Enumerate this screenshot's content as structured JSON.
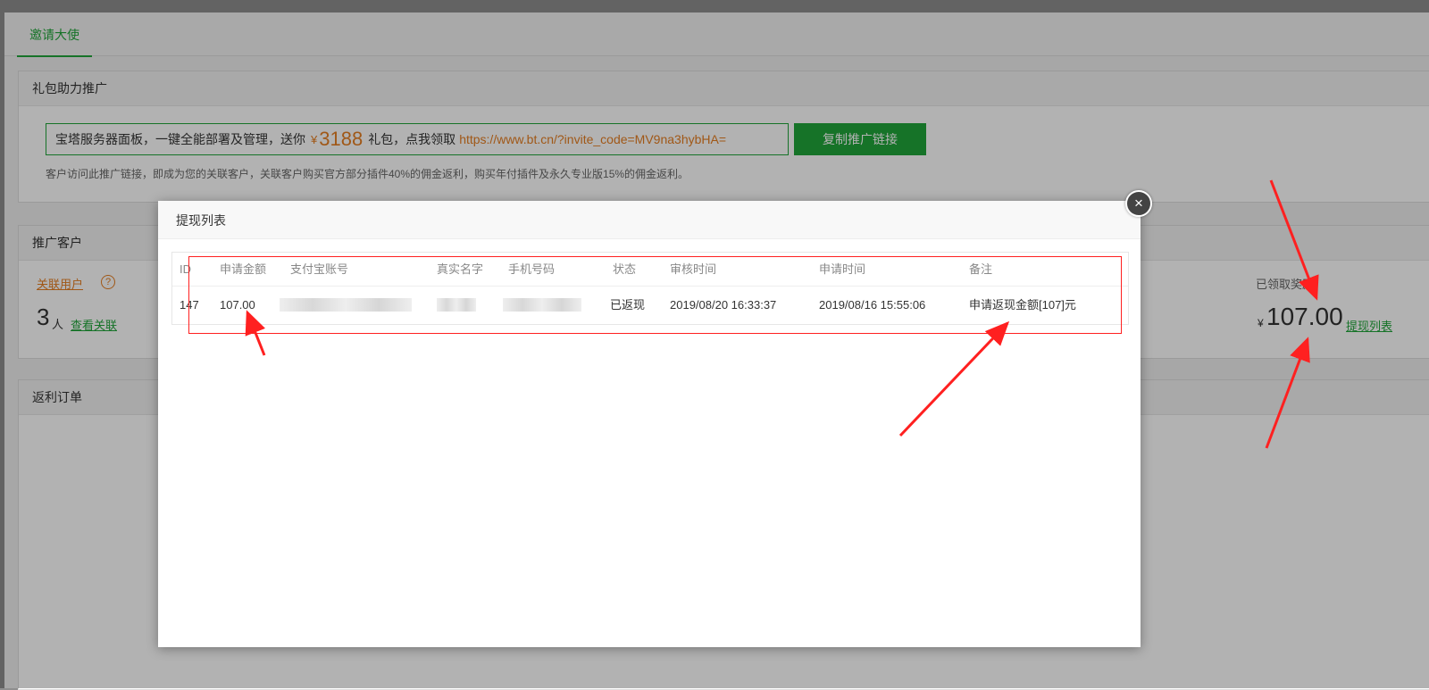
{
  "tabs": {
    "active": "邀请大使"
  },
  "gift_panel": {
    "title": "礼包助力推广",
    "invite_prefix": "宝塔服务器面板，一键全能部署及管理，送你",
    "currency": "¥",
    "gift_amount": "3188",
    "invite_middle": "礼包，点我领取",
    "invite_url": "https://www.bt.cn/?invite_code=MV9na3hybHA=",
    "copy_button": "复制推广链接",
    "note": "客户访问此推广链接，即成为您的关联客户，关联客户购买官方部分插件40%的佣金返利，购买年付插件及永久专业版15%的佣金返利。"
  },
  "customers_panel": {
    "title": "推广客户",
    "linked_users_label": "关联用户",
    "help_icon": "?",
    "count": "3",
    "count_unit": "人",
    "view_link": "查看关联",
    "reward_label": "已领取奖励",
    "reward_currency": "¥",
    "reward_value": "107.00",
    "withdraw_list_link": "提现列表"
  },
  "orders_panel": {
    "title": "返利订单"
  },
  "modal": {
    "title": "提现列表",
    "close_icon": "×",
    "columns": [
      "ID",
      "申请金额",
      "支付宝账号",
      "真实名字",
      "手机号码",
      "状态",
      "审核时间",
      "申请时间",
      "备注"
    ],
    "rows": [
      {
        "id": "147",
        "amount": "107.00",
        "status": "已返现",
        "review_time": "2019/08/20 16:33:37",
        "apply_time": "2019/08/16 15:55:06",
        "remark": "申请返现金额[107]元"
      }
    ]
  },
  "colors": {
    "brand_green": "#20a53a",
    "accent_orange": "#e67e22",
    "annotation_red": "#ff2020"
  },
  "icons": [
    "question-icon",
    "close-icon",
    "arrow-annotation"
  ]
}
